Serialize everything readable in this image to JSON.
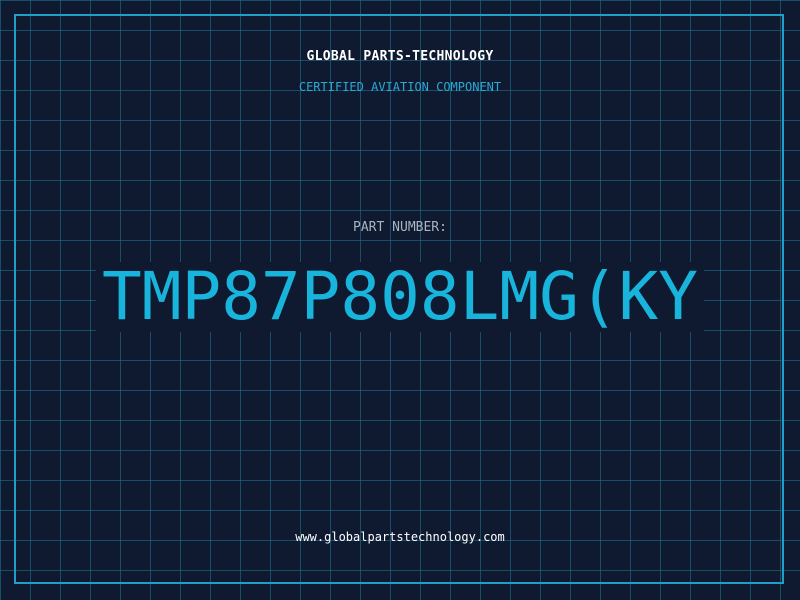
{
  "header": {
    "brand": "GLOBAL PARTS-TECHNOLOGY",
    "subtitle": "CERTIFIED AVIATION COMPONENT"
  },
  "part": {
    "label": "PART NUMBER:",
    "value": "TMP87P808LMG(KY"
  },
  "footer": {
    "website": "www.globalpartstechnology.com"
  },
  "colors": {
    "background": "#0f1a30",
    "grid": "#1c7896",
    "frame": "#1ea0c8",
    "accent": "#18b4dc",
    "text": "#ffffff",
    "muted": "#a9b4c2"
  }
}
